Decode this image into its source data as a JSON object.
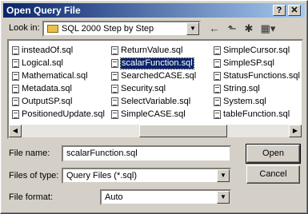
{
  "window": {
    "title": "Open Query File",
    "help_glyph": "?",
    "close_glyph": "✕"
  },
  "look_in": {
    "label": "Look in:",
    "value": "SQL 2000 Step by Step"
  },
  "toolbar": {
    "back_glyph": "←",
    "up_glyph": "⬑",
    "new_folder_glyph": "✱",
    "views_glyph": "▦▾"
  },
  "files": {
    "col1": [
      "insteadOf.sql",
      "Logical.sql",
      "Mathematical.sql",
      "Metadata.sql",
      "OutputSP.sql",
      "PositionedUpdate.sql"
    ],
    "col2": [
      "ReturnValue.sql",
      "scalarFunction.sql",
      "SearchedCASE.sql",
      "Security.sql",
      "SelectVariable.sql",
      "SimpleCASE.sql"
    ],
    "col3": [
      "SimpleCursor.sql",
      "SimpleSP.sql",
      "StatusFunctions.sql",
      "String.sql",
      "System.sql",
      "tableFunction.sql"
    ],
    "selected": "scalarFunction.sql"
  },
  "form": {
    "file_name_label": "File name:",
    "file_name_value": "scalarFunction.sql",
    "files_of_type_label": "Files of type:",
    "files_of_type_value": "Query Files (*.sql)",
    "file_format_label": "File format:",
    "file_format_value": "Auto"
  },
  "buttons": {
    "open": "Open",
    "cancel": "Cancel"
  }
}
